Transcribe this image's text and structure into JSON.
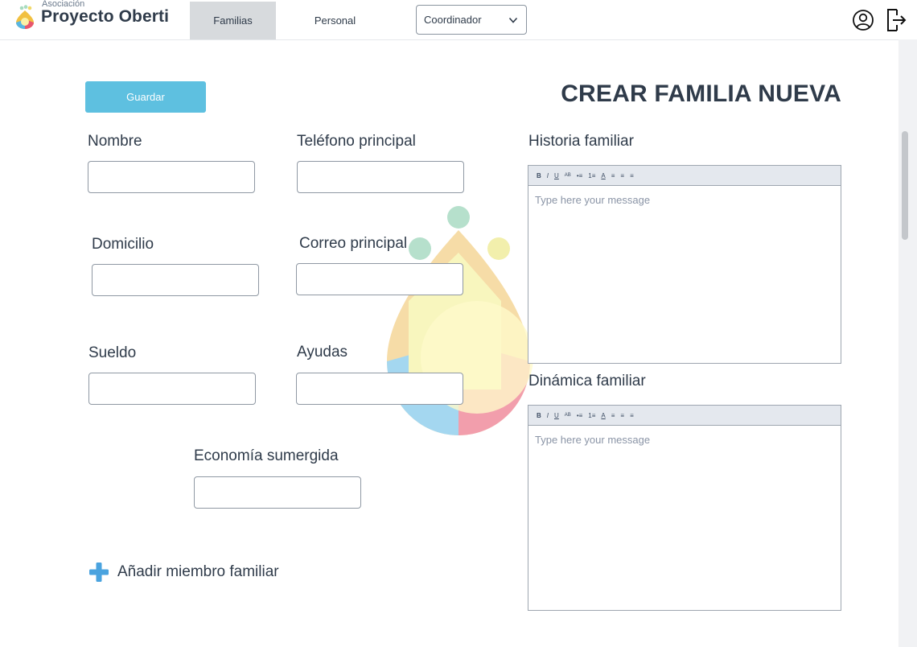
{
  "header": {
    "logo_small": "Asociación",
    "logo_main": "Proyecto Oberti",
    "tabs": [
      {
        "label": "Familias",
        "active": true
      },
      {
        "label": "Personal",
        "active": false
      }
    ],
    "role_select": {
      "value": "Coordinador"
    },
    "icons": {
      "user": "user-circle-icon",
      "logout": "logout-icon"
    }
  },
  "form": {
    "save_label": "Guardar",
    "title": "CREAR FAMILIA NUEVA",
    "fields": {
      "nombre": {
        "label": "Nombre",
        "value": ""
      },
      "telefono": {
        "label": "Teléfono principal",
        "value": ""
      },
      "domicilio": {
        "label": "Domicilio",
        "value": ""
      },
      "correo": {
        "label": "Correo principal",
        "value": ""
      },
      "sueldo": {
        "label": "Sueldo",
        "value": ""
      },
      "ayudas": {
        "label": "Ayudas",
        "value": ""
      },
      "economia": {
        "label": "Economía sumergida",
        "value": ""
      }
    },
    "editors": {
      "historia": {
        "label": "Historia familiar",
        "placeholder": "Type here your message"
      },
      "dinamica": {
        "label": "Dinámica familiar",
        "placeholder": "Type here your message"
      }
    },
    "toolbar_buttons": [
      "B",
      "I",
      "U",
      "AB",
      "•≡",
      "1≡",
      "A",
      "≡",
      "≡",
      "≡"
    ],
    "add_member_label": "Añadir miembro familiar"
  },
  "colors": {
    "accent_button": "#5ec0e0",
    "active_tab": "#d7dadd",
    "text": "#2f3b4a",
    "add_icon": "#4aa3df"
  }
}
